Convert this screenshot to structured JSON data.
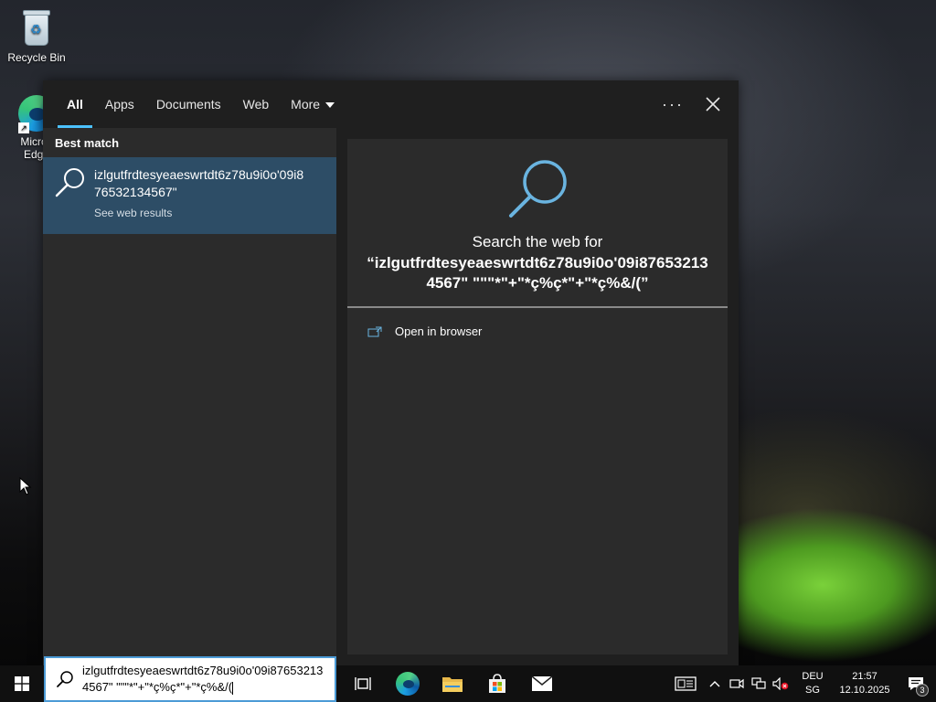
{
  "desktop": {
    "icons": [
      {
        "label": "Recycle Bin"
      },
      {
        "label": "Microsoft Edge",
        "label_visible": "Micros\nEdge"
      }
    ]
  },
  "search": {
    "tabs": [
      {
        "label": "All",
        "active": true
      },
      {
        "label": "Apps"
      },
      {
        "label": "Documents"
      },
      {
        "label": "Web"
      },
      {
        "label": "More"
      }
    ],
    "more_options": "···",
    "best_match_label": "Best match",
    "best_match": {
      "title": "izlgutfrdtesyeaeswrtdt6z78u9i0o'09i876532134567\"",
      "subtitle": "See web results"
    },
    "preview": {
      "heading": "Search the web for",
      "query": "“izlgutfrdtesyeaeswrtdt6z78u9i0o'09i876532134567\" \"\"\"*\"+\"*ç%ç*\"+\"*ç%&/(”",
      "action": "Open in browser"
    },
    "input_value": "izlgutfrdtesyeaeswrtdt6z78u9i0o'09i876532134567\" \"\"\"*\"+\"*ç%ç*\"+\"*ç%&/("
  },
  "taskbar": {
    "language": {
      "line1": "DEU",
      "line2": "SG"
    },
    "clock": {
      "time": "21:57",
      "date": "12.10.2025"
    },
    "notification_count": "3"
  },
  "colors": {
    "accent": "#4cc2ff",
    "best_match_bg": "#2d4d66",
    "panel_bg": "#2b2b2b"
  }
}
